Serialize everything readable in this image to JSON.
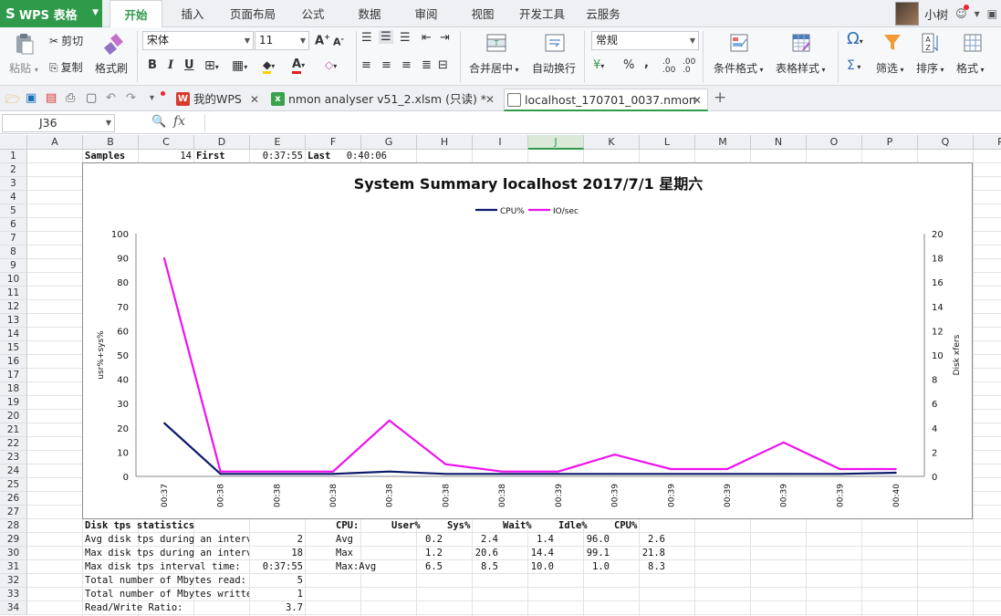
{
  "app": {
    "name": "WPS 表格",
    "logo": "S"
  },
  "menu_tabs": [
    "开始",
    "插入",
    "页面布局",
    "公式",
    "数据",
    "审阅",
    "视图",
    "开发工具",
    "云服务"
  ],
  "active_menu_tab": "开始",
  "user": {
    "name": "小树"
  },
  "ribbon": {
    "paste": "粘贴",
    "cut": "剪切",
    "copy": "复制",
    "format_painter": "格式刷",
    "font_name": "宋体",
    "font_size": "11",
    "bold": "B",
    "italic": "I",
    "underline": "U",
    "merge_center": "合并居中",
    "wrap_text": "自动换行",
    "number_format": "常规",
    "percent": "%",
    "comma": ",",
    "cond_format": "条件格式",
    "table_style": "表格样式",
    "sum": "Σ",
    "filter": "筛选",
    "sort": "排序",
    "format": "格式"
  },
  "doc_tabs": [
    {
      "label": "我的WPS",
      "icon": "W"
    },
    {
      "label": "nmon analyser v51_2.xlsm (只读) *",
      "icon": "x"
    },
    {
      "label": "localhost_170701_0037.nmon",
      "icon": ""
    }
  ],
  "active_doc_tab": 2,
  "formula_bar": {
    "cell_ref": "J36",
    "fx": "fx",
    "formula": ""
  },
  "sheet": {
    "columns": [
      "A",
      "B",
      "C",
      "D",
      "E",
      "F",
      "G",
      "H",
      "I",
      "J",
      "K",
      "L",
      "M",
      "N",
      "O",
      "P",
      "Q",
      "R"
    ],
    "selected_column": "J",
    "rows": [
      "1",
      "2",
      "3",
      "4",
      "5",
      "6",
      "7",
      "8",
      "9",
      "10",
      "11",
      "12",
      "13",
      "14",
      "15",
      "16",
      "17",
      "18",
      "19",
      "20",
      "21",
      "22",
      "23",
      "24",
      "25",
      "26",
      "27",
      "28",
      "29",
      "30",
      "31",
      "32",
      "33",
      "34"
    ],
    "row1": {
      "samples_label": "Samples",
      "samples_value": "14",
      "first_label": "First",
      "first_value": "0:37:55",
      "last_label": "Last",
      "last_value": "0:40:06"
    },
    "disk_stats": {
      "header": "Disk tps statistics",
      "rows": [
        {
          "label": "Avg disk tps during an interva",
          "value": "2"
        },
        {
          "label": "Max disk tps during an interva",
          "value": "18"
        },
        {
          "label": "Max disk tps interval time:",
          "value": "0:37:55"
        },
        {
          "label": "Total number of Mbytes read:",
          "value": "5"
        },
        {
          "label": "Total number of Mbytes written",
          "value": "1"
        },
        {
          "label": "Read/Write Ratio:",
          "value": "3.7"
        }
      ]
    },
    "cpu_table": {
      "headers": [
        "CPU:",
        "User%",
        "Sys%",
        "Wait%",
        "Idle%",
        "CPU%"
      ],
      "rows": [
        [
          "Avg",
          "0.2",
          "2.4",
          "1.4",
          "96.0",
          "2.6"
        ],
        [
          "Max",
          "1.2",
          "20.6",
          "14.4",
          "99.1",
          "21.8"
        ],
        [
          "Max:Avg",
          "6.5",
          "8.5",
          "10.0",
          "1.0",
          "8.3"
        ]
      ]
    }
  },
  "chart_data": {
    "type": "line",
    "title": "System Summary localhost  2017/7/1 星期六",
    "categories": [
      "00:37",
      "00:38",
      "00:38",
      "00:38",
      "00:38",
      "00:38",
      "00:38",
      "00:39",
      "00:39",
      "00:39",
      "00:39",
      "00:39",
      "00:39",
      "00:40"
    ],
    "series": [
      {
        "name": "CPU%",
        "axis": "left",
        "color": "#0b1a6b",
        "values": [
          22,
          1,
          1,
          1,
          2,
          1,
          1,
          1,
          1,
          1,
          1,
          1,
          1,
          1.5
        ]
      },
      {
        "name": "IO/sec",
        "axis": "right",
        "color": "#ee11ee",
        "values": [
          18,
          0.4,
          0.4,
          0.4,
          4.6,
          1,
          0.4,
          0.4,
          1.8,
          0.6,
          0.6,
          2.8,
          0.6,
          0.6
        ]
      }
    ],
    "ylabel_left": "usr%+sys%",
    "ylabel_right": "Disk xfers",
    "ylim_left": [
      0,
      100
    ],
    "yticks_left": [
      "0",
      "10",
      "20",
      "30",
      "40",
      "50",
      "60",
      "70",
      "80",
      "90",
      "100"
    ],
    "ylim_right": [
      0,
      20
    ],
    "yticks_right": [
      "0",
      "2",
      "4",
      "6",
      "8",
      "10",
      "12",
      "14",
      "16",
      "18",
      "20"
    ],
    "legend_position": "top-center",
    "grid": false
  }
}
